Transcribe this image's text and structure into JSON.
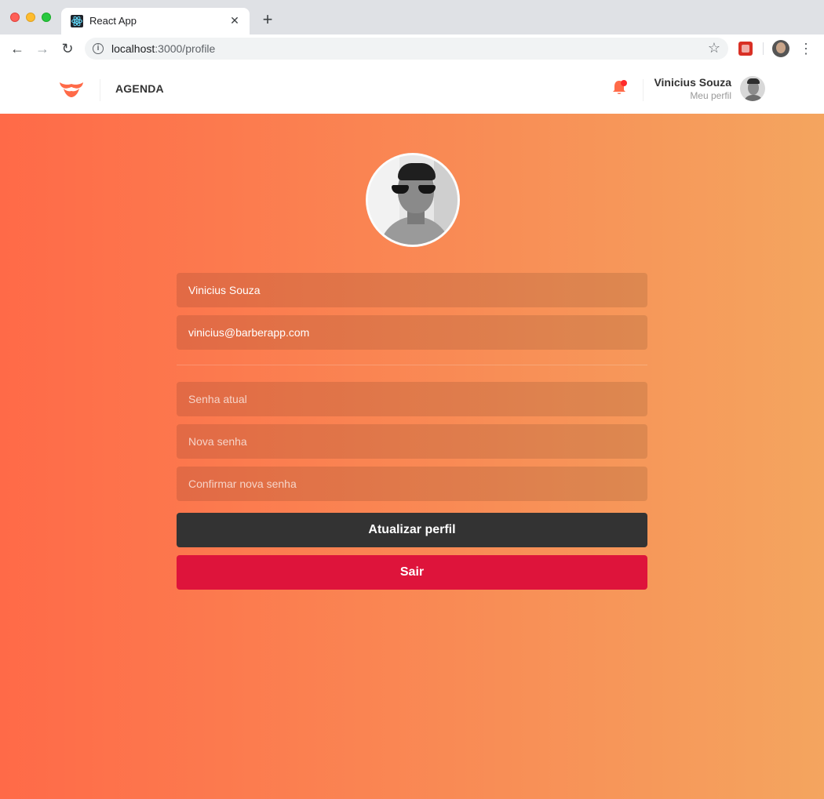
{
  "browser": {
    "tab_title": "React App",
    "tab_close": "✕",
    "new_tab": "+",
    "url_host": "localhost",
    "url_path": ":3000/profile",
    "icons": {
      "back": "arrow-left-icon",
      "forward": "arrow-right-icon",
      "reload": "reload-icon",
      "info": "info-icon",
      "bookmark": "star-icon",
      "extension": "extension-icon",
      "profile": "profile-avatar-icon",
      "menu": "menu-dots-icon"
    }
  },
  "header": {
    "nav_link": "AGENDA",
    "user_name": "Vinicius Souza",
    "profile_link": "Meu perfil",
    "has_notifications": true,
    "colors": {
      "logo": "#ff6a48",
      "bell": "#ff6a48",
      "badge": "#ff2b2b"
    }
  },
  "profile_form": {
    "name_value": "Vinicius Souza",
    "email_value": "vinicius@barberapp.com",
    "old_password_placeholder": "Senha atual",
    "new_password_placeholder": "Nova senha",
    "confirm_password_placeholder": "Confirmar nova senha",
    "submit_label": "Atualizar perfil",
    "exit_label": "Sair"
  },
  "colors": {
    "gradient_start": "#ff6a48",
    "gradient_end": "#f4a55f",
    "update_button": "#333333",
    "exit_button": "#de143b"
  }
}
